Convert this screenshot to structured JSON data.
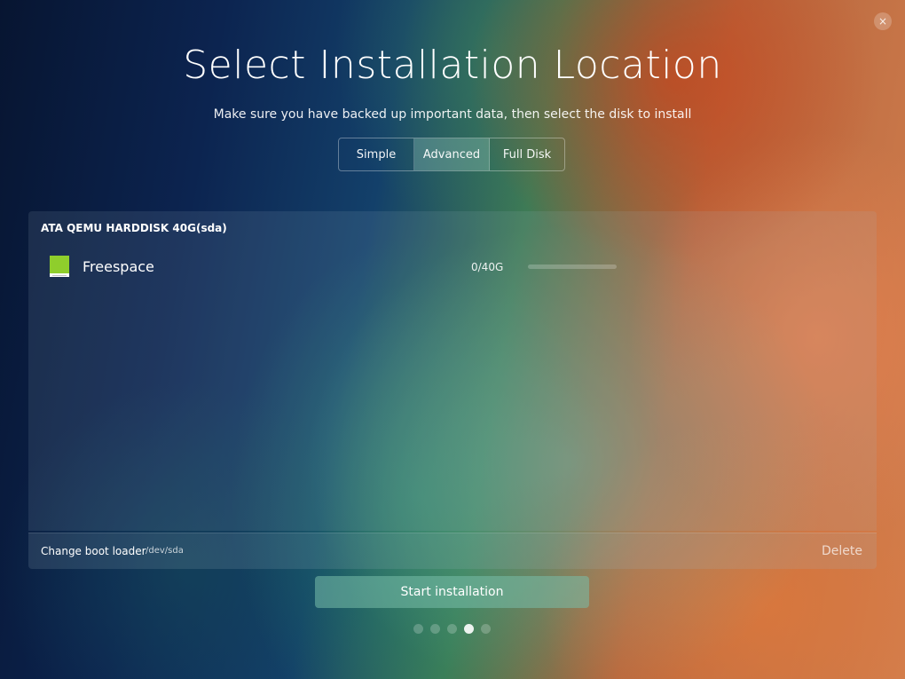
{
  "window": {
    "close_glyph": "×"
  },
  "header": {
    "title": "Select Installation Location",
    "subtitle": "Make sure you have backed up important data, then select the disk to install"
  },
  "mode_tabs": [
    {
      "label": "Simple",
      "active": false
    },
    {
      "label": "Advanced",
      "active": true
    },
    {
      "label": "Full Disk",
      "active": false
    }
  ],
  "disk": {
    "name": "ATA QEMU HARDDISK 40G(sda)",
    "partitions": [
      {
        "label": "Freespace",
        "size": "0/40G",
        "usage_fraction": 0
      }
    ]
  },
  "bottom_bar": {
    "boot_loader_label": "Change boot loader",
    "boot_device": "/dev/sda",
    "delete_label": "Delete"
  },
  "footer": {
    "start_label": "Start installation",
    "steps_total": 5,
    "current_step": 4
  },
  "colors": {
    "partition_icon": "#8fce2c",
    "accent": "#78beaa"
  }
}
